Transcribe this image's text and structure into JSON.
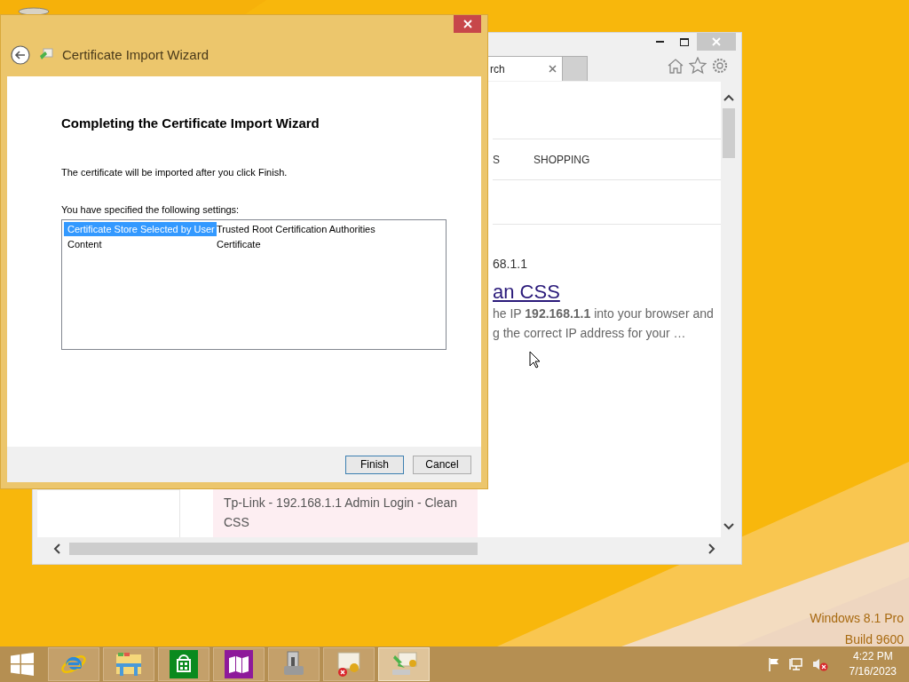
{
  "desktop": {
    "os_edition": [
      "Windows 8.1 Pro",
      "Build 9600"
    ]
  },
  "browser": {
    "tab": {
      "title": "rch",
      "selected": true
    },
    "nav_items": [
      "S",
      "SHOPPING"
    ],
    "result": {
      "url": "68.1.1",
      "title": "an CSS",
      "snippet": [
        "he IP **192.168.1.1** into your browser and",
        "g the correct IP address for your …"
      ]
    },
    "related": {
      "title": "Tp-Link - 192.168.1.1 Admin Login - Clean CSS"
    }
  },
  "dialog": {
    "title": "Certificate Import Wizard",
    "heading": "Completing the Certificate Import Wizard",
    "message": "The certificate will be imported after you click Finish.",
    "settings_label": "You have specified the following settings:",
    "settings": [
      {
        "name": "Certificate Store Selected by User",
        "value": "Trusted Root Certification Authorities",
        "selected": true
      },
      {
        "name": "Content",
        "value": "Certificate",
        "selected": false
      }
    ],
    "buttons": [
      {
        "label": "Finish",
        "default": true
      },
      {
        "label": "Cancel",
        "default": false
      }
    ]
  },
  "taskbar": {
    "apps": [
      {
        "kind": "browser",
        "active": false
      },
      {
        "kind": "folder",
        "active": false
      },
      {
        "kind": "store",
        "active": false
      },
      {
        "kind": "reader",
        "active": false
      },
      {
        "kind": "manager",
        "active": false
      },
      {
        "kind": "cert-error",
        "active": false
      },
      {
        "kind": "cert-import",
        "active": true
      }
    ],
    "clock": {
      "time": "4:22 PM",
      "date": "7/16/2023"
    }
  }
}
